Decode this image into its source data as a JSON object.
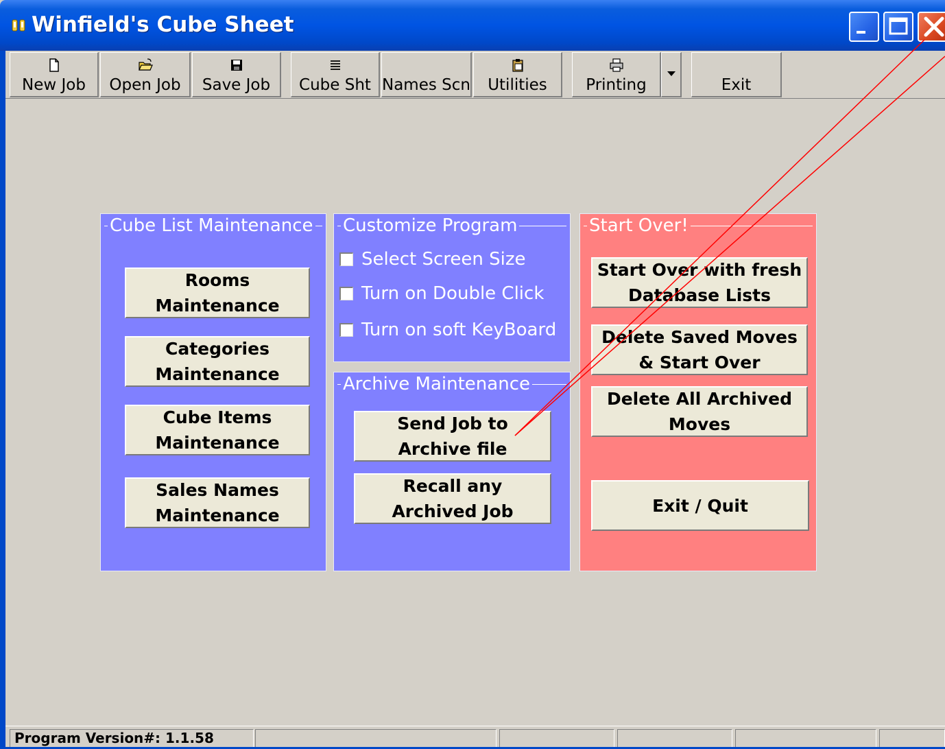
{
  "window": {
    "title": "Winfield's Cube Sheet"
  },
  "toolbar": {
    "new_job": "New Job",
    "open_job": "Open Job",
    "save_job": "Save Job",
    "cube_sht": "Cube Sht",
    "names_scn": "Names Scn",
    "utilities": "Utilities",
    "printing": "Printing",
    "exit": "Exit"
  },
  "panels": {
    "cube_list": {
      "legend": "Cube List Maintenance",
      "buttons": [
        "Rooms\nMaintenance",
        "Categories\nMaintenance",
        "Cube Items\nMaintenance",
        "Sales Names\nMaintenance"
      ]
    },
    "customize": {
      "legend": "Customize Program",
      "options": [
        {
          "label": "Select Screen Size",
          "checked": false
        },
        {
          "label": "Turn on Double Click",
          "checked": false
        },
        {
          "label": "Turn on soft KeyBoard",
          "checked": false
        }
      ]
    },
    "archive": {
      "legend": "Archive Maintenance",
      "buttons": [
        "Send Job to\nArchive file",
        "Recall any\nArchived Job"
      ]
    },
    "start_over": {
      "legend": "Start Over!",
      "buttons": [
        "Start Over with fresh\nDatabase Lists",
        "Delete Saved Moves\n& Start Over",
        "Delete All Archived\nMoves",
        "Exit / Quit"
      ]
    }
  },
  "status": {
    "version": "Program Version#: 1.1.58"
  },
  "colors": {
    "title_bar": "#0054e3",
    "panel_blue": "#8080ff",
    "panel_red": "#ff8080",
    "window_bg": "#d4d0c8",
    "button_face": "#ece9d8",
    "annotation_line": "#ff0000"
  }
}
